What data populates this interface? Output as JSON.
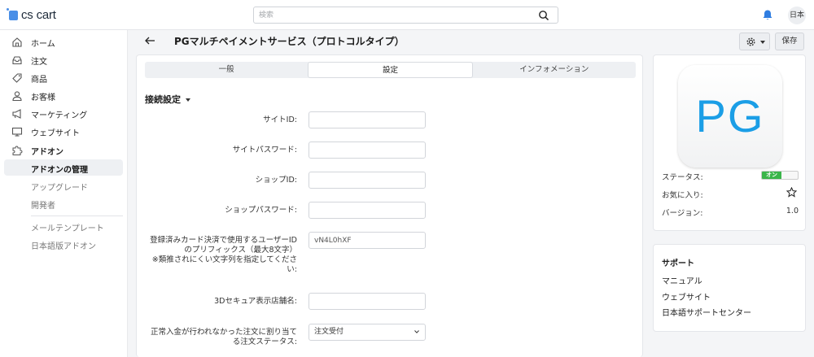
{
  "topbar": {
    "logo_text": "cs cart",
    "search_placeholder": "検索",
    "lang_label": "日本"
  },
  "sidebar": {
    "items": [
      {
        "label": "ホーム",
        "icon": "home-icon"
      },
      {
        "label": "注文",
        "icon": "inbox-icon"
      },
      {
        "label": "商品",
        "icon": "tag-icon"
      },
      {
        "label": "お客様",
        "icon": "user-icon"
      },
      {
        "label": "マーケティング",
        "icon": "megaphone-icon"
      },
      {
        "label": "ウェブサイト",
        "icon": "monitor-icon"
      },
      {
        "label": "アドオン",
        "icon": "puzzle-icon"
      }
    ],
    "addon_subitems": [
      {
        "label": "アドオンの管理",
        "active": true
      },
      {
        "label": "アップグレード",
        "active": false
      },
      {
        "label": "開発者",
        "active": false
      },
      {
        "label": "メールテンプレート",
        "active": false
      },
      {
        "label": "日本語版アドオン",
        "active": false
      }
    ]
  },
  "header": {
    "title": "PGマルチペイメントサービス（プロトコルタイプ）",
    "save_label": "保存"
  },
  "tabs": [
    {
      "label": "一般",
      "active": false
    },
    {
      "label": "設定",
      "active": true
    },
    {
      "label": "インフォメーション",
      "active": false
    }
  ],
  "section": {
    "title": "接続設定"
  },
  "fields": {
    "site_id_label": "サイトID:",
    "site_id_value": "",
    "site_password_label": "サイトパスワード:",
    "site_password_value": "",
    "shop_id_label": "ショップID:",
    "shop_id_value": "",
    "shop_password_label": "ショップパスワード:",
    "shop_password_value": "",
    "prefix_label_1": "登録済みカード決済で使用するユーザーID",
    "prefix_label_2": "のプリフィックス（最大8文字）",
    "prefix_label_3": "※類推されにくい文字列を指定してくださ",
    "prefix_label_4": "い:",
    "prefix_value": "vN4L0hXF",
    "store_name_label": "3Dセキュア表示店舗名:",
    "store_name_value": "",
    "status_label_1": "正常入金が行われなかった注文に割り当て",
    "status_label_2": "る注文ステータス:",
    "status_value": "注文受付"
  },
  "info": {
    "logo_text": "PG",
    "status_label": "ステータス:",
    "status_toggle": "オン",
    "favorite_label": "お気に入り:",
    "version_label": "バージョン:",
    "version_value": "1.0"
  },
  "support": {
    "title": "サポート",
    "links": [
      "マニュアル",
      "ウェブサイト",
      "日本語サポートセンター"
    ]
  },
  "colors": {
    "accent_blue": "#1b9ee6",
    "toggle_green": "#3bb54a",
    "bell_blue": "#2f7de1"
  }
}
